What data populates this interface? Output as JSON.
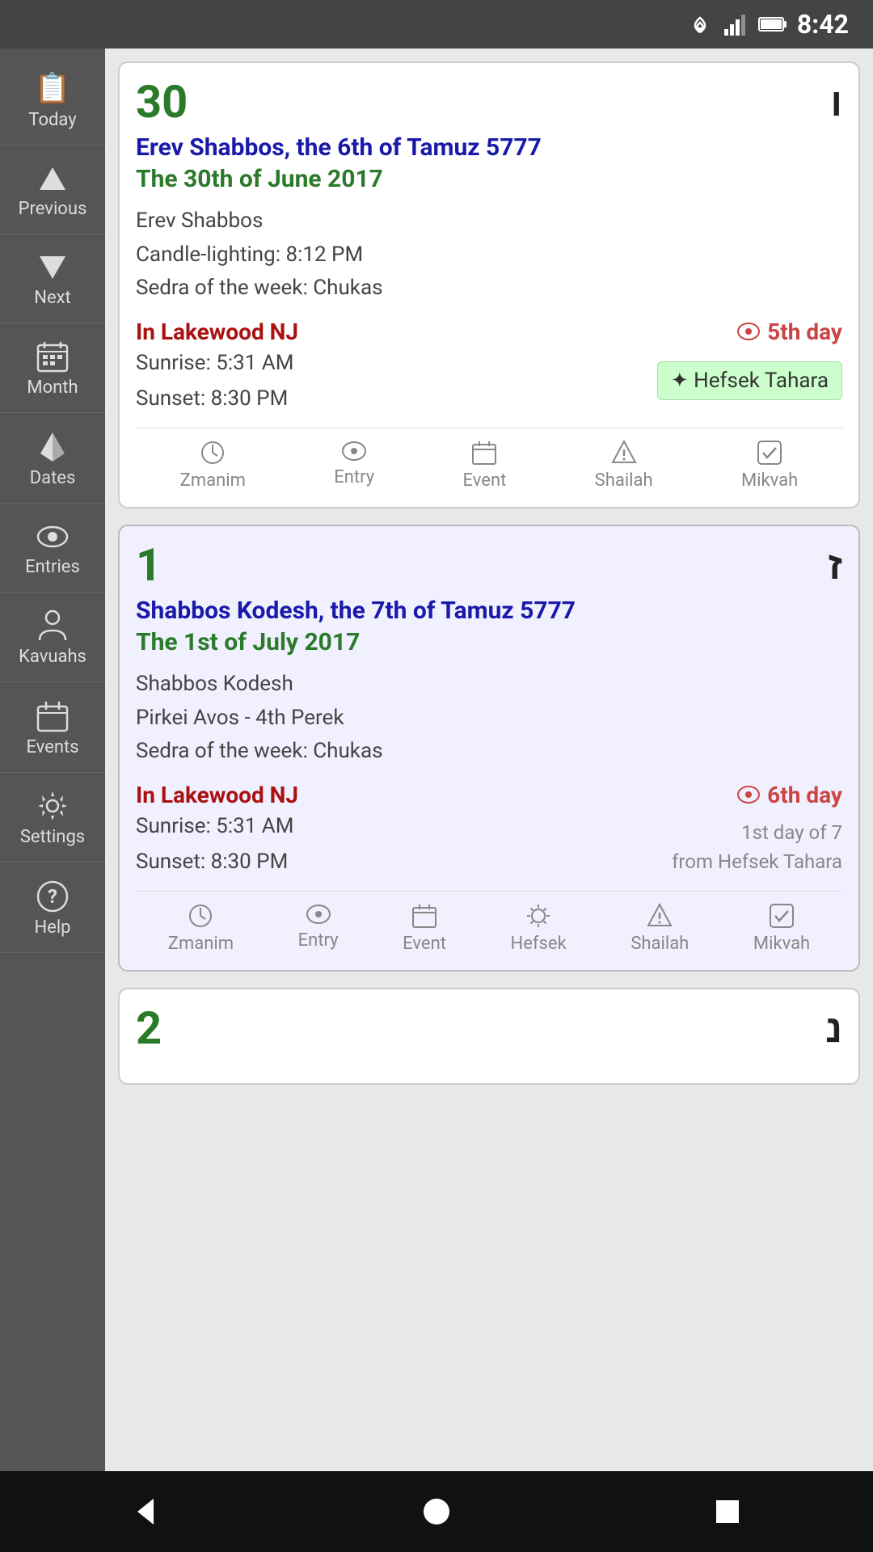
{
  "statusBar": {
    "time": "8:42",
    "icons": [
      "wifi",
      "signal",
      "battery"
    ]
  },
  "sidebar": {
    "items": [
      {
        "id": "today",
        "label": "Today",
        "icon": "📋"
      },
      {
        "id": "previous",
        "label": "Previous",
        "icon": "⬆"
      },
      {
        "id": "next",
        "label": "Next",
        "icon": "⬇"
      },
      {
        "id": "month",
        "label": "Month",
        "icon": "📅"
      },
      {
        "id": "dates",
        "label": "Dates",
        "icon": "🚩"
      },
      {
        "id": "entries",
        "label": "Entries",
        "icon": "👁"
      },
      {
        "id": "kavuahs",
        "label": "Kavuahs",
        "icon": "👤"
      },
      {
        "id": "events",
        "label": "Events",
        "icon": "📆"
      },
      {
        "id": "settings",
        "label": "Settings",
        "icon": "⚙"
      },
      {
        "id": "help",
        "label": "Help",
        "icon": "❓"
      }
    ]
  },
  "cards": [
    {
      "id": "day30",
      "dayNumber": "30",
      "hebrewDay": "ו",
      "highlighted": false,
      "jewishDate": "Erev Shabbos, the 6th of Tamuz 5777",
      "gregorianDate": "The 30th of June 2017",
      "details": [
        "Erev Shabbos",
        "Candle-lighting: 8:12 PM",
        "Sedra of the week: Chukas"
      ],
      "location": "In Lakewood NJ",
      "dayBadge": "5th day",
      "sunrise": "5:31 AM",
      "sunset": "8:30 PM",
      "hefsekBadge": "✦ Hefsek Tahara",
      "taharaInfo": null,
      "actions": [
        {
          "id": "zmanim",
          "label": "Zmanim",
          "icon": "🕐"
        },
        {
          "id": "entry",
          "label": "Entry",
          "icon": "👁"
        },
        {
          "id": "event",
          "label": "Event",
          "icon": "📅"
        },
        {
          "id": "shailah",
          "label": "Shailah",
          "icon": "⚠"
        },
        {
          "id": "mikvah",
          "label": "Mikvah",
          "icon": "✅"
        }
      ]
    },
    {
      "id": "day1",
      "dayNumber": "1",
      "hebrewDay": "ז",
      "highlighted": true,
      "jewishDate": "Shabbos Kodesh, the 7th of Tamuz 5777",
      "gregorianDate": "The 1st of July 2017",
      "details": [
        "Shabbos Kodesh",
        "Pirkei Avos - 4th Perek",
        "Sedra of the week: Chukas"
      ],
      "location": "In Lakewood NJ",
      "dayBadge": "6th day",
      "sunrise": "5:31 AM",
      "sunset": "8:30 PM",
      "hefsekBadge": null,
      "taharaInfo": "1st day of 7\nfrom Hefsek Tahara",
      "actions": [
        {
          "id": "zmanim",
          "label": "Zmanim",
          "icon": "🕐"
        },
        {
          "id": "entry",
          "label": "Entry",
          "icon": "👁"
        },
        {
          "id": "event",
          "label": "Event",
          "icon": "📅"
        },
        {
          "id": "hefsek",
          "label": "Hefsek",
          "icon": "✦"
        },
        {
          "id": "shailah",
          "label": "Shailah",
          "icon": "⚠"
        },
        {
          "id": "mikvah",
          "label": "Mikvah",
          "icon": "✅"
        }
      ]
    },
    {
      "id": "day2",
      "dayNumber": "2",
      "hebrewDay": "נ",
      "highlighted": false,
      "jewishDate": null,
      "gregorianDate": null,
      "details": [],
      "location": null,
      "dayBadge": null,
      "sunrise": null,
      "sunset": null,
      "hefsekBadge": null,
      "taharaInfo": null,
      "actions": []
    }
  ],
  "bottomBar": {
    "back": "◀",
    "home": "●",
    "recents": "■"
  }
}
